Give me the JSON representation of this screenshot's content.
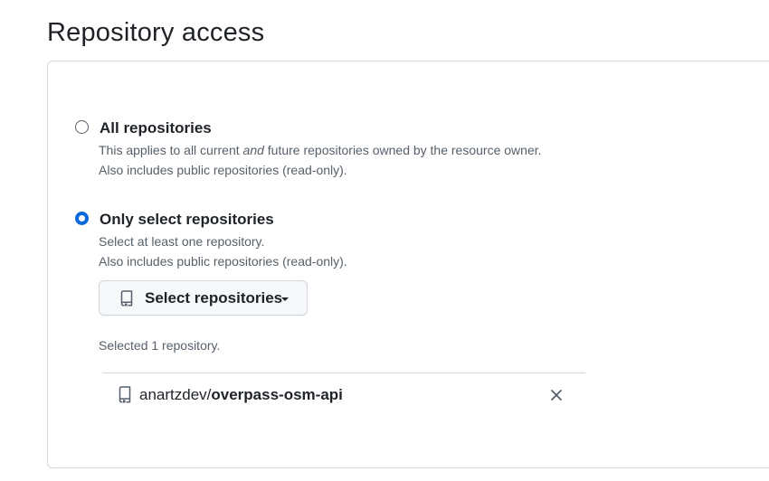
{
  "page": {
    "title": "Repository access"
  },
  "options": [
    {
      "label": "All repositories",
      "desc_line1_before": "This applies to all current ",
      "desc_line1_em": "and",
      "desc_line1_after": " future repositories owned by the resource owner.",
      "desc_line2": "Also includes public repositories (read-only).",
      "checked": false
    },
    {
      "label": "Only select repositories",
      "desc_line1": "Select at least one repository.",
      "desc_line2": "Also includes public repositories (read-only).",
      "checked": true
    }
  ],
  "select_button": {
    "label": "Select repositories",
    "icon": "repo-icon"
  },
  "selected_count": "Selected 1 repository.",
  "repositories": [
    {
      "owner": "anartzdev/",
      "name": "overpass-osm-api",
      "icon": "repo-icon",
      "remove_icon": "close-icon"
    }
  ],
  "colors": {
    "accent": "#0969da",
    "text": "#1f2328",
    "muted": "#57606a",
    "border": "#d0d7de",
    "button_bg": "#f6f8fa"
  }
}
